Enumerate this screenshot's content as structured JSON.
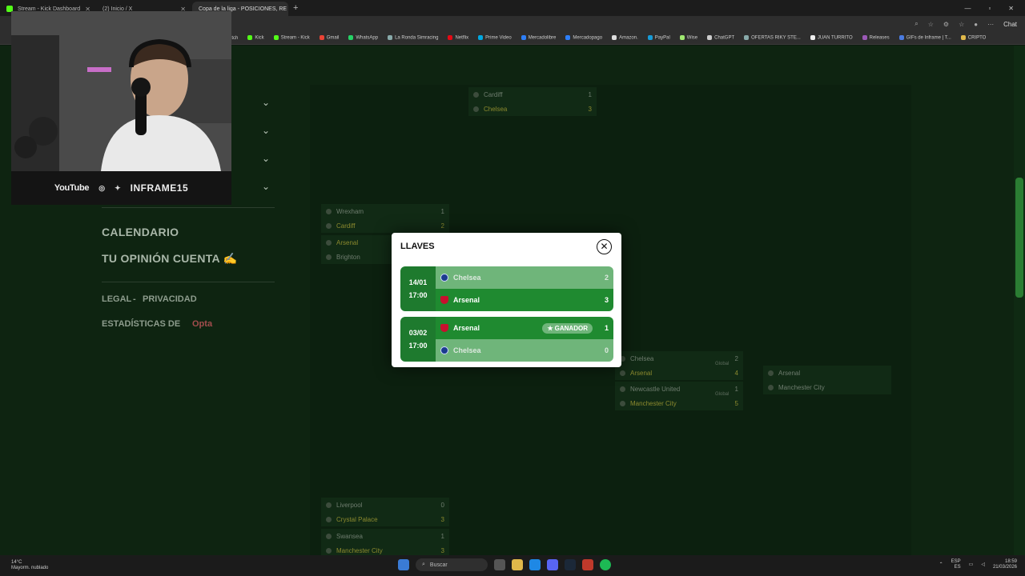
{
  "browser": {
    "tabs": [
      {
        "label": "Stream - Kick Dashboard",
        "active": false
      },
      {
        "label": "(2) Inicio / X",
        "active": false
      },
      {
        "label": "Copa de la liga - POSICIONES, RE",
        "active": true
      }
    ],
    "toolbar_right": "Chat",
    "bookmarks": [
      "itch",
      "Kick",
      "Stream - Kick",
      "Gmail",
      "WhatsApp",
      "La Ronda Simracing",
      "Netflix",
      "Prime Video",
      "Mercadolibre",
      "Mercadopago",
      "Amazon.",
      "PayPal",
      "Wise",
      "ChatGPT",
      "OFERTAS RIKY STE...",
      "JUAN TURRITO",
      "Releases",
      "GIFs de Inframe | T...",
      "CRIPTO"
    ]
  },
  "webcam": {
    "youtube": "YouTube",
    "handle": "INFRAME15"
  },
  "sidebar": {
    "calendario": "CALENDARIO",
    "opinion": "TU OPINIÓN CUENTA ✍",
    "legal": "LEGAL",
    "sep": "-",
    "privacidad": "PRIVACIDAD",
    "stats": "ESTADÍSTICAS DE",
    "opta": "Opta"
  },
  "bracket": {
    "top_final": [
      {
        "team": "Cardiff",
        "score": "1"
      },
      {
        "team": "Chelsea",
        "score": "3"
      }
    ],
    "qf1": [
      {
        "team": "Wrexham",
        "score": "1"
      },
      {
        "team": "Cardiff",
        "score": "2"
      }
    ],
    "qf2": [
      {
        "team": "Arsenal",
        "score": ""
      },
      {
        "team": "Brighton",
        "score": ""
      }
    ],
    "sf1": [
      {
        "team": "Chelsea",
        "score": "2"
      },
      {
        "team": "Arsenal",
        "score": "4"
      }
    ],
    "sf2": [
      {
        "team": "Newcastle United",
        "score": "1"
      },
      {
        "team": "Manchester City",
        "score": "5"
      }
    ],
    "global_label": "Global",
    "final": [
      {
        "team": "Arsenal"
      },
      {
        "team": "Manchester City"
      }
    ],
    "qf3": [
      {
        "team": "Liverpool",
        "score": "0"
      },
      {
        "team": "Crystal Palace",
        "score": "3"
      }
    ],
    "qf4": [
      {
        "team": "Swansea",
        "score": "1"
      },
      {
        "team": "Manchester City",
        "score": "3"
      }
    ]
  },
  "modal": {
    "title": "LLAVES",
    "ties": [
      {
        "date": "14/01",
        "time": "17:00",
        "home": {
          "team": "Chelsea",
          "score": "2"
        },
        "away": {
          "team": "Arsenal",
          "score": "3"
        }
      },
      {
        "date": "03/02",
        "time": "17:00",
        "home": {
          "team": "Arsenal",
          "score": "1"
        },
        "away": {
          "team": "Chelsea",
          "score": "0"
        },
        "badge": "GANADOR"
      }
    ]
  },
  "taskbar": {
    "temp": "14°C",
    "weather": "Mayorm. nublado",
    "search": "Buscar",
    "lang": "ESP",
    "region": "ES",
    "time": "18:59",
    "date": "21/03/2026"
  }
}
